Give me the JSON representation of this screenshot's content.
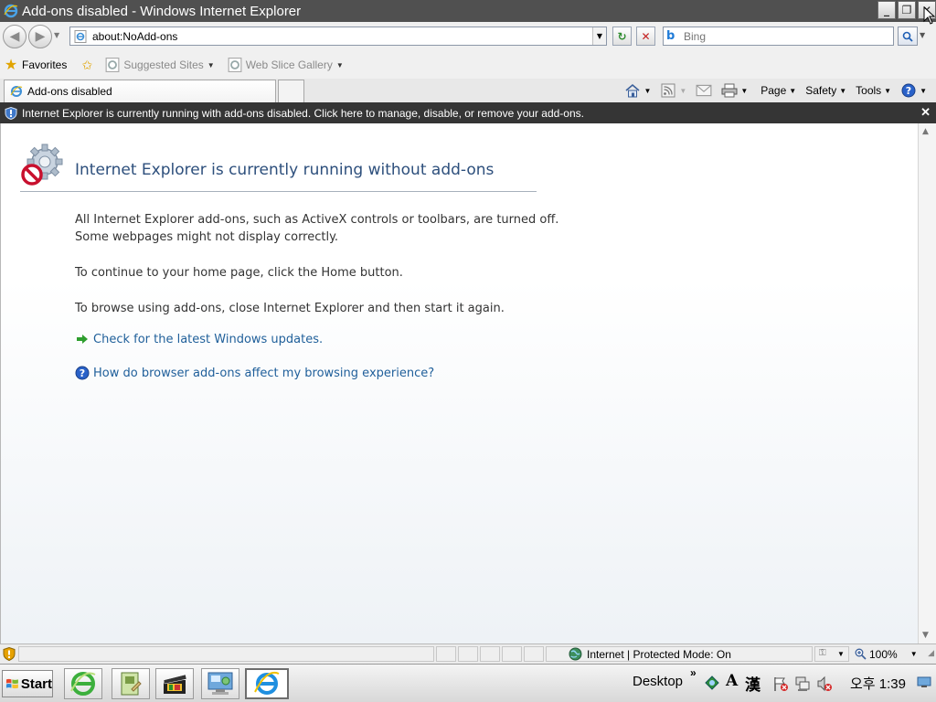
{
  "window": {
    "title": "Add-ons disabled - Windows Internet Explorer",
    "minimize_label": "_",
    "restore_label": "❐",
    "close_label": "✕"
  },
  "navbar": {
    "back_label": "◀",
    "forward_label": "▶",
    "address": "about:NoAdd-ons",
    "refresh_label": "↻",
    "stop_label": "✕",
    "search_placeholder": "Bing",
    "search_button_label": "🔍"
  },
  "favorites_bar": {
    "favorites_label": "Favorites",
    "items": [
      {
        "label": "Suggested Sites"
      },
      {
        "label": "Web Slice Gallery"
      }
    ]
  },
  "tabs": {
    "active": "Add-ons disabled"
  },
  "command_bar": {
    "page": "Page",
    "safety": "Safety",
    "tools": "Tools"
  },
  "infobar": {
    "text": "Internet Explorer is currently running with add-ons disabled. Click here to manage, disable, or remove your add-ons.",
    "close_label": "✕"
  },
  "content": {
    "heading": "Internet Explorer is currently running without add-ons",
    "para1_line1": "All Internet Explorer add-ons, such as ActiveX controls or toolbars, are turned off.",
    "para1_line2": "Some webpages might not display correctly.",
    "para2": "To continue to your home page, click the Home button.",
    "para3": "To browse using add-ons, close Internet Explorer and then start it again.",
    "link1": "Check for the latest Windows updates.",
    "link2": "How do browser add-ons affect my browsing experience?"
  },
  "statusbar": {
    "zone": "Internet | Protected Mode: On",
    "zoom": "100%"
  },
  "taskbar": {
    "start_label": "Start",
    "desktop_label": "Desktop",
    "overflow_label": "»",
    "ime_a": "A",
    "ime_han": "漢",
    "clock": "오후 1:39"
  },
  "colors": {
    "heading": "#2d4f7c",
    "link": "#1f5f9a",
    "infobar_bg": "#353535",
    "titlebar_bg": "#505050"
  }
}
